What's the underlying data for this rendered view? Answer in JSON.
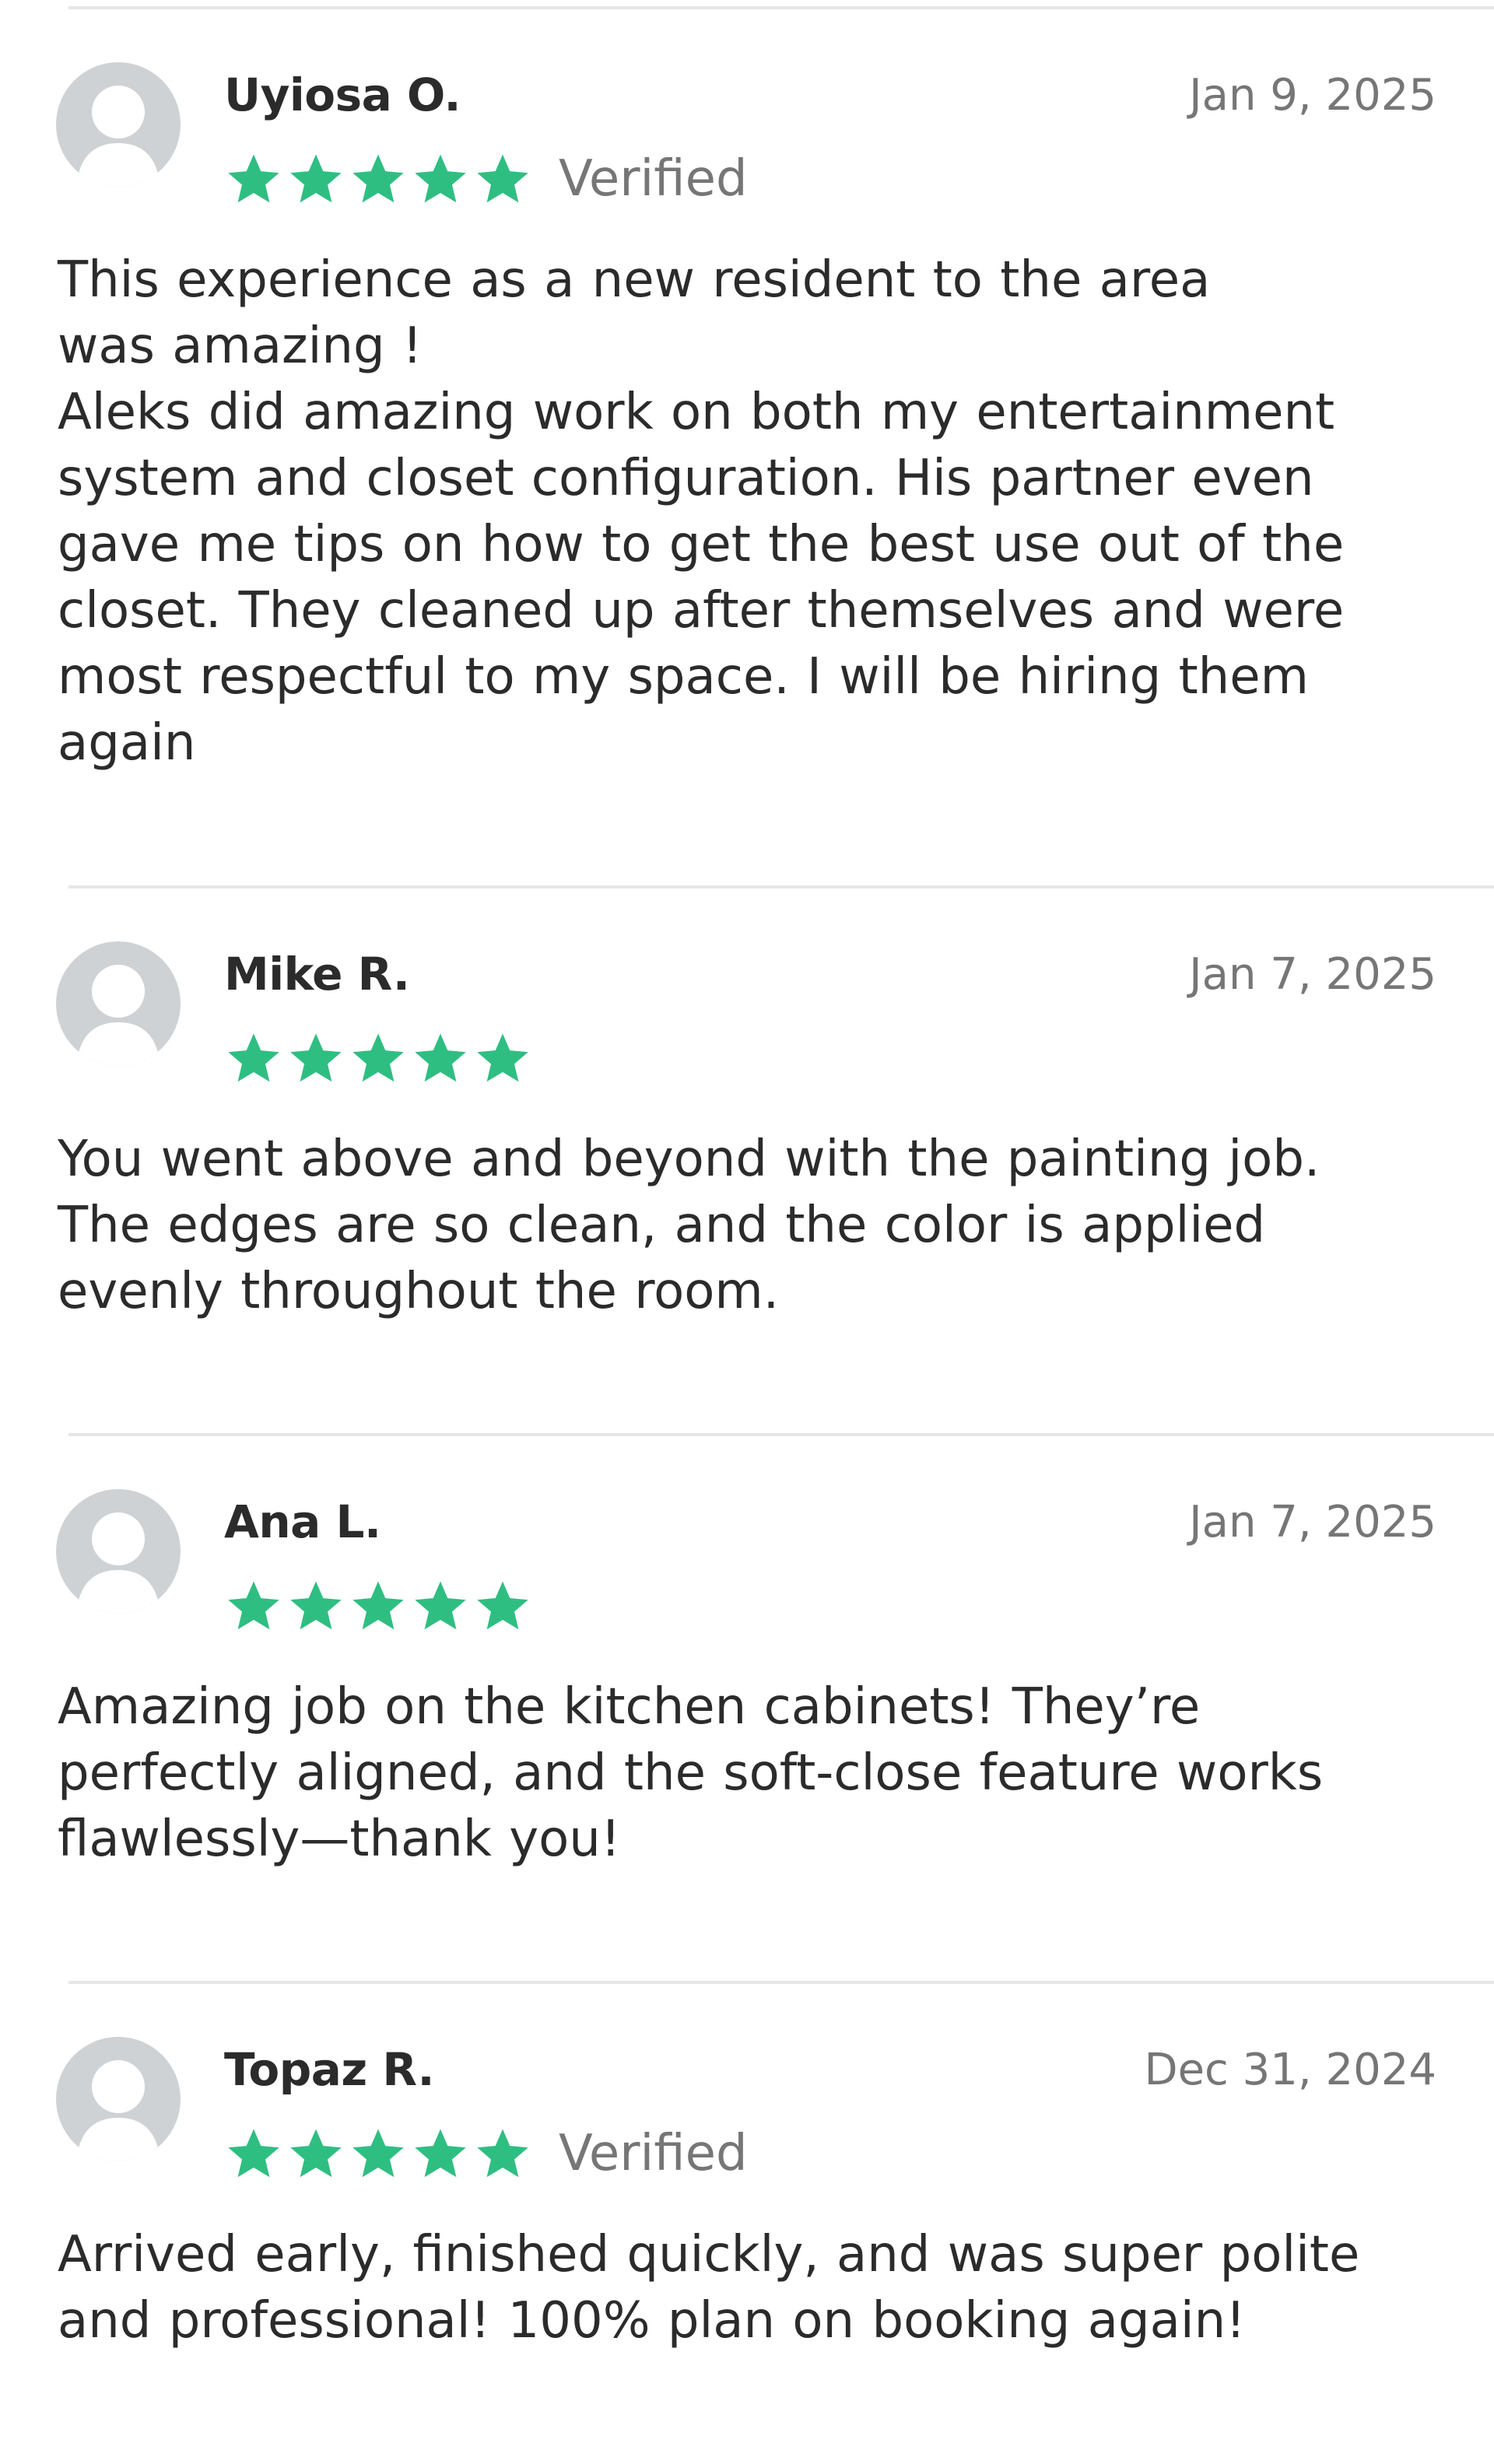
{
  "theme": {
    "star_color": "#2fbe82",
    "avatar_color": "#cfd2d5",
    "divider_color": "#e6e6e6"
  },
  "reviews": [
    {
      "name": "Uyiosa O.",
      "date": "Jan 9, 2025",
      "rating": 5,
      "verified_label": "Verified",
      "text": "This experience as a new resident to the area\nwas amazing !\nAleks did amazing work on both my entertainment\nsystem and closet configuration. His partner even\ngave me tips on how to get the best use out of the\ncloset. They cleaned up after themselves and were\nmost respectful to my space. I will be hiring them\nagain"
    },
    {
      "name": "Mike R.",
      "date": "Jan 7, 2025",
      "rating": 5,
      "verified_label": "",
      "text": "You went above and beyond with the painting job.\nThe edges are so clean, and the color is applied\nevenly throughout the room."
    },
    {
      "name": "Ana L.",
      "date": "Jan 7, 2025",
      "rating": 5,
      "verified_label": "",
      "text": "Amazing job on the kitchen cabinets! They’re\nperfectly aligned, and the soft-close feature works\nflawlessly—thank you!"
    },
    {
      "name": "Topaz R.",
      "date": "Dec 31, 2024",
      "rating": 5,
      "verified_label": "Verified",
      "text": "Arrived early, finished quickly, and was super polite\nand professional! 100% plan on booking again!"
    }
  ]
}
